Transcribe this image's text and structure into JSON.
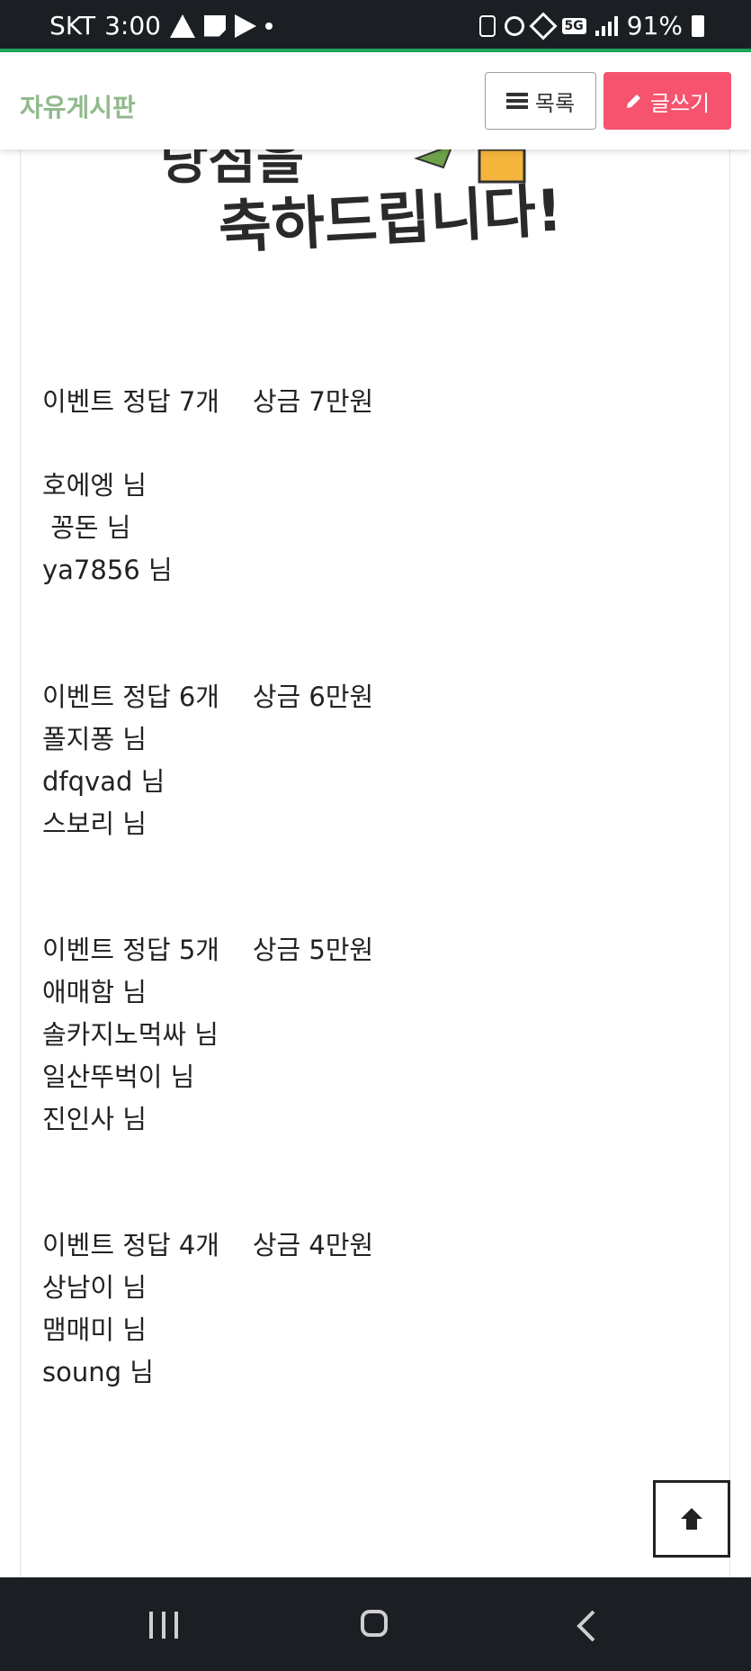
{
  "status_bar": {
    "carrier": "SKT",
    "time": "3:00",
    "network": "5G",
    "battery": "91%"
  },
  "header": {
    "title": "자유게시판",
    "list_label": "목록",
    "write_label": "글쓰기",
    "write_color": "#f5536e",
    "title_color": "#8fb98b"
  },
  "banner": {
    "line1": "당첨을",
    "line2": "축하드립니다!"
  },
  "sections": [
    {
      "heading": "이벤트 정답 7개    상금 7만원",
      "winners": [
        "호에엥 님",
        " 꽁돈 님",
        "ya7856 님"
      ]
    },
    {
      "heading": "이벤트 정답 6개    상금 6만원",
      "winners": [
        "폴지퐁 님",
        "dfqvad 님",
        "스보리 님"
      ]
    },
    {
      "heading": "이벤트 정답 5개    상금 5만원",
      "winners": [
        "애매함 님",
        "솔카지노먹싸 님",
        "일산뚜벅이 님",
        "진인사 님"
      ]
    },
    {
      "heading": "이벤트 정답 4개    상금 4만원",
      "winners": [
        "상남이 님",
        "맴매미 님",
        "soung 님"
      ]
    }
  ]
}
